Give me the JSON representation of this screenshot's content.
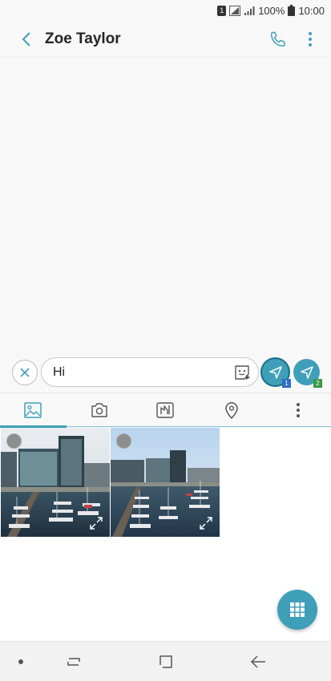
{
  "status_bar": {
    "sim": "1",
    "battery": "100%",
    "time": "10:00"
  },
  "header": {
    "contact_name": "Zoe Taylor"
  },
  "compose": {
    "message": "Hi",
    "send_sim1_label": "1",
    "send_sim2_label": "2"
  },
  "attach_tabs": {
    "icons": [
      "gallery-icon",
      "camera-icon",
      "drawing-icon",
      "location-icon",
      "more-icon"
    ],
    "active": "gallery"
  },
  "colors": {
    "accent": "#3f9fb8",
    "sim1": "#2d6fc2",
    "sim2": "#3a9a44"
  }
}
